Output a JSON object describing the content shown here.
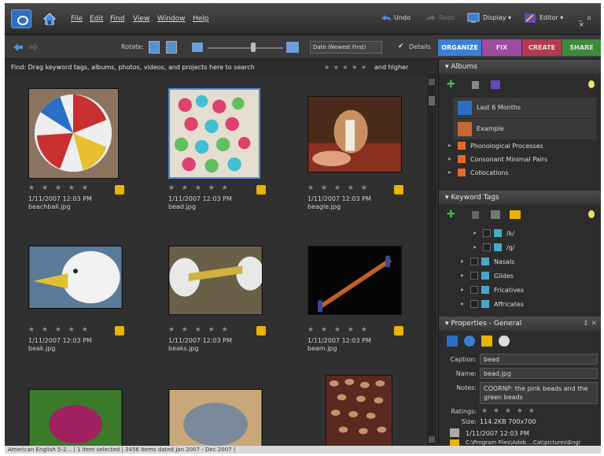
{
  "menu": [
    "File",
    "Edit",
    "Find",
    "View",
    "Window",
    "Help"
  ],
  "toolbar": {
    "undo": "Undo",
    "redo": "Redo",
    "display": "Display ▾",
    "editor": "Editor ▾",
    "win_controls": "_ ▫ ✕"
  },
  "toolbar2": {
    "rotate": "Rotate:",
    "sort": "Date (Newest First)",
    "details": "Details"
  },
  "tabs": [
    {
      "label": "ORGANIZE",
      "color": "#3a7fd5"
    },
    {
      "label": "FIX",
      "color": "#b04fb6"
    },
    {
      "label": "CREATE",
      "color": "#c93a55"
    },
    {
      "label": "SHARE",
      "color": "#3d9a3a"
    }
  ],
  "find_bar": {
    "text": "Find: Drag keyword tags, albums, photos, videos, and projects here to search",
    "rating_label": "and higher",
    "stars": "★ ★ ★ ★ ★"
  },
  "photos": [
    {
      "date": "1/11/2007 12:03 PM",
      "name": "beachball.jpg",
      "stars": "★ ★ ★ ★ ★"
    },
    {
      "date": "1/11/2007 12:03 PM",
      "name": "bead.jpg",
      "stars": "★ ★ ★ ★ ★"
    },
    {
      "date": "1/11/2007 12:03 PM",
      "name": "beagle.jpg",
      "stars": "★ ★ ★ ★ ★"
    },
    {
      "date": "1/11/2007 12:03 PM",
      "name": "beak.jpg",
      "stars": "★ ★ ★ ★ ★"
    },
    {
      "date": "1/11/2007 12:03 PM",
      "name": "beaks.jpg",
      "stars": "★ ★ ★ ★ ★"
    },
    {
      "date": "1/11/2007 12:03 PM",
      "name": "beam.jpg",
      "stars": "★ ★ ★ ★ ★"
    }
  ],
  "albums": {
    "title": "Albums",
    "smart": [
      {
        "label": "Last 6 Months"
      },
      {
        "label": "Example"
      }
    ],
    "items": [
      {
        "label": "Phonological Processes"
      },
      {
        "label": "Consonant Minimal Pairs"
      },
      {
        "label": "Collocations"
      }
    ]
  },
  "keywords": {
    "title": "Keyword Tags",
    "items": [
      {
        "label": "/k/"
      },
      {
        "label": "/g/"
      },
      {
        "label": "Nasals"
      },
      {
        "label": "Glides"
      },
      {
        "label": "Fricatives"
      },
      {
        "label": "Affricates"
      }
    ]
  },
  "properties": {
    "title": "Properties - General",
    "caption_label": "Caption:",
    "caption": "bead",
    "name_label": "Name:",
    "name": "bead.jpg",
    "notes_label": "Notes:",
    "notes": "COORNP: the pink beads and the green beads",
    "ratings_label": "Ratings:",
    "ratings": "★ ★ ★ ★ ★",
    "size_label": "Size:",
    "size": "114.2KB 700x700",
    "date": "1/11/2007 12:03 PM",
    "path": "C:\\Program Files\\Adob....Cat\\pictures\\Engl"
  },
  "status": {
    "text": "American English 5-2...  |  1 item selected  |  3456 items dated Jan 2007 - Dec 2007  |"
  },
  "colors": {
    "accent": "#3a7fd5",
    "folder": "#e8692a",
    "tag": "#e9b300"
  }
}
